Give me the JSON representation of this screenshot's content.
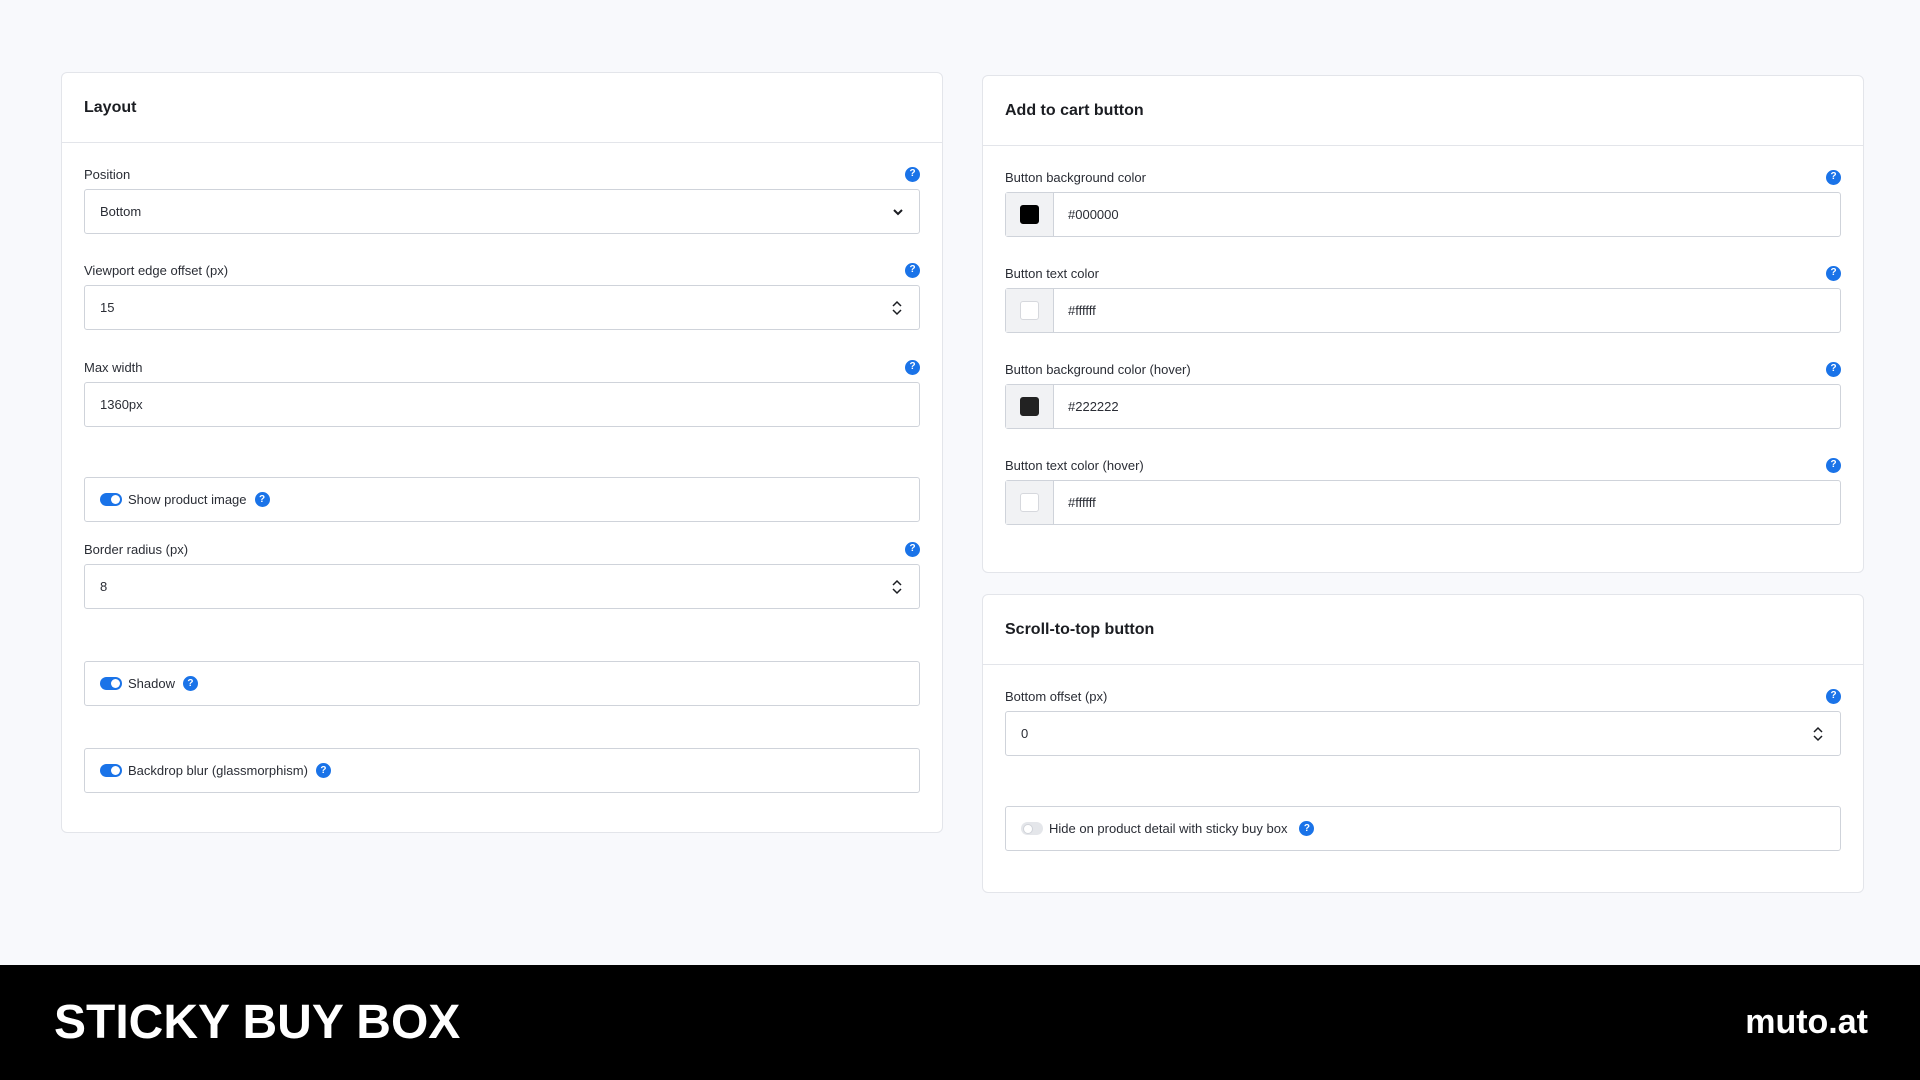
{
  "layout": {
    "title": "Layout",
    "position": {
      "label": "Position",
      "value": "Bottom"
    },
    "viewport_offset": {
      "label": "Viewport edge offset (px)",
      "value": "15"
    },
    "max_width": {
      "label": "Max width",
      "value": "1360px"
    },
    "show_product_image": {
      "label": "Show product image",
      "enabled": true
    },
    "border_radius": {
      "label": "Border radius (px)",
      "value": "8"
    },
    "shadow": {
      "label": "Shadow",
      "enabled": true
    },
    "backdrop_blur": {
      "label": "Backdrop blur (glassmorphism)",
      "enabled": true
    }
  },
  "add_to_cart": {
    "title": "Add to cart button",
    "bg_color": {
      "label": "Button background color",
      "value": "#000000",
      "swatch": "#000000"
    },
    "text_color": {
      "label": "Button text color",
      "value": "#ffffff",
      "swatch": "#ffffff"
    },
    "bg_color_hover": {
      "label": "Button background color (hover)",
      "value": "#222222",
      "swatch": "#222222"
    },
    "text_color_hover": {
      "label": "Button text color (hover)",
      "value": "#ffffff",
      "swatch": "#ffffff"
    }
  },
  "scroll_top": {
    "title": "Scroll-to-top button",
    "bottom_offset": {
      "label": "Bottom offset (px)",
      "value": "0"
    },
    "hide_on_product": {
      "label": "Hide on product detail with sticky buy box",
      "enabled": false
    }
  },
  "help_glyph": "?",
  "footer": {
    "brand": "STICKY BUY BOX",
    "domain": "muto.at"
  },
  "colors": {
    "accent": "#1a73e8",
    "footer_bg": "#000000",
    "page_bg": "#f8f9fc"
  }
}
